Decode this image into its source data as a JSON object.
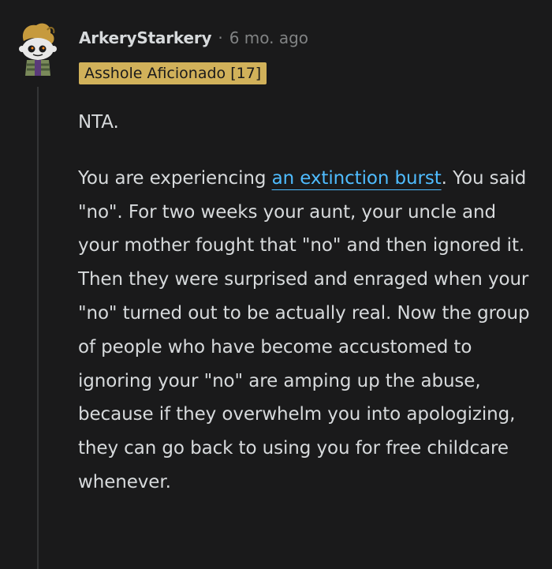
{
  "comment": {
    "username": "ArkeryStarkery",
    "separator": "·",
    "age": "6 mo. ago",
    "flair": "Asshole Aficionado [17]",
    "paragraph1": "NTA.",
    "paragraph2": {
      "before_link": "You are experiencing ",
      "link_text": "an extinction burst",
      "after_link": ". You said \"no\". For two weeks your aunt, your uncle and your mother fought that \"no\" and then ignored it. Then they were surprised and enraged when your \"no\" turned out to be actually real. Now the group of people who have become accustomed to ignoring your \"no\" are amping up the abuse, because if they overwhelm you into apologizing, they can go back to using you for free childcare whenever."
    }
  },
  "colors": {
    "background": "#1a1a1b",
    "text": "#d7dadc",
    "meta": "#818384",
    "link": "#4fbcff",
    "flair_bg": "#d1b15a",
    "thread_line": "#343536"
  },
  "icons": {
    "avatar": "snoo-avatar-icon"
  }
}
